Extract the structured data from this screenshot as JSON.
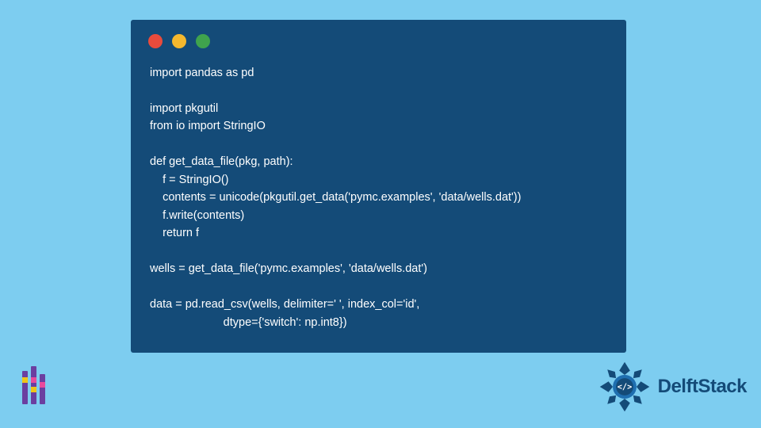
{
  "window": {
    "dots": [
      "red",
      "yellow",
      "green"
    ]
  },
  "code": "import pandas as pd\n\nimport pkgutil\nfrom io import StringIO\n\ndef get_data_file(pkg, path):\n    f = StringIO()\n    contents = unicode(pkgutil.get_data('pymc.examples', 'data/wells.dat'))\n    f.write(contents)\n    return f\n\nwells = get_data_file('pymc.examples', 'data/wells.dat')\n\ndata = pd.read_csv(wells, delimiter=' ', index_col='id',\n                       dtype={'switch': np.int8})",
  "brand": {
    "name": "DelftStack"
  }
}
